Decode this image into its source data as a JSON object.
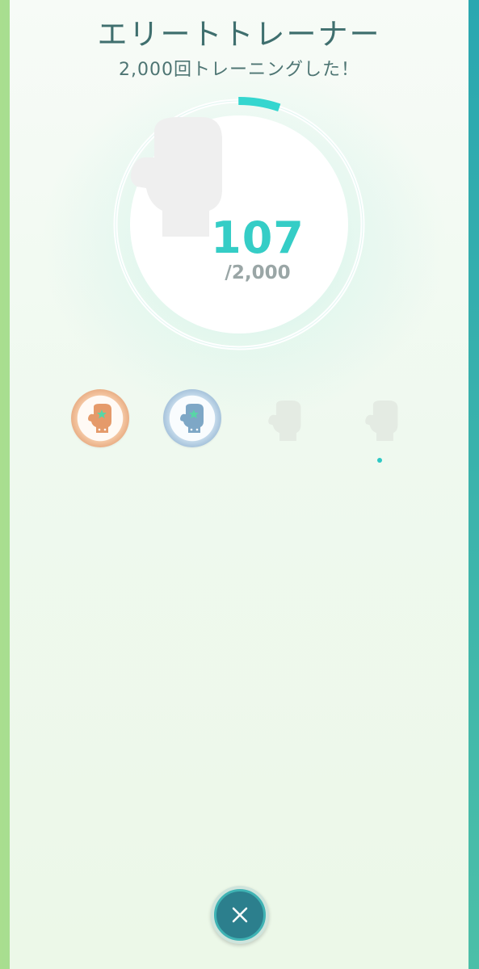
{
  "header": {
    "title": "エリートトレーナー",
    "subtitle": "2,000回トレーニングした！"
  },
  "progress": {
    "current": "107",
    "goal": "/2,000",
    "fraction": 0.0535
  },
  "medals": [
    {
      "tier": "bronze",
      "unlocked": true,
      "icon": "boxing-glove-star-icon"
    },
    {
      "tier": "silver",
      "unlocked": true,
      "icon": "boxing-glove-star-icon"
    },
    {
      "tier": "gold",
      "unlocked": false,
      "icon": "boxing-glove-icon"
    },
    {
      "tier": "platinum",
      "unlocked": false,
      "icon": "boxing-glove-icon"
    }
  ],
  "close": {
    "icon": "close-icon"
  },
  "colors": {
    "accent": "#35cdc6",
    "close_button": "#2c7f8d",
    "bronze": "#eab087",
    "silver": "#a8c4dc"
  }
}
